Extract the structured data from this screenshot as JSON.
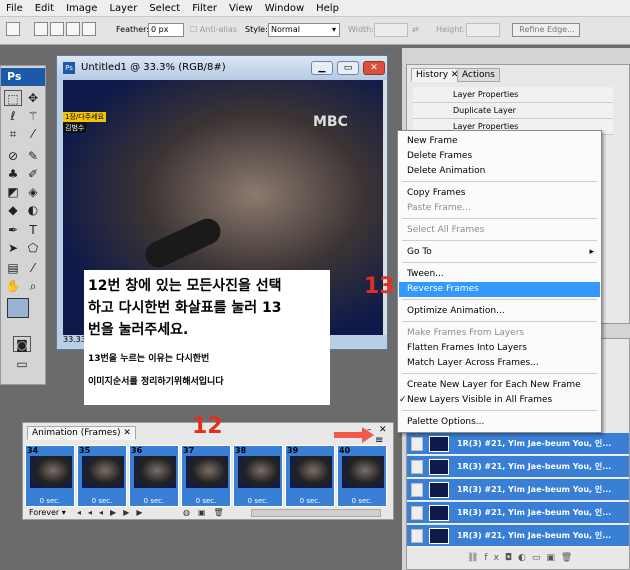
{
  "menubar": [
    "File",
    "Edit",
    "Image",
    "Layer",
    "Select",
    "Filter",
    "View",
    "Window",
    "Help"
  ],
  "options": {
    "feather_label": "Feather:",
    "feather_value": "0 px",
    "antialias_label": "Anti-alias",
    "style_label": "Style:",
    "style_value": "Normal",
    "width_label": "Width:",
    "height_label": "Height:",
    "refine_edge": "Refine Edge..."
  },
  "tools": {
    "ps_label": "Ps"
  },
  "document": {
    "title": "Untitled1 @ 33.3% (RGB/8#)",
    "zoom": "33.33",
    "overlay_tags": [
      "1장/다주세요",
      "김범수"
    ],
    "broadcast_logo": "MBC"
  },
  "note": {
    "line1": "12번 창에 있는 모든사진을 선택",
    "line2": "하고 다시한번 화살표를 눌러 13",
    "line3": "번을 눌러주세요.",
    "line4": "13번을 누르는 이유는 다시한번",
    "line5": "이미지순서를 정리하기위해서입니다"
  },
  "markers": {
    "m12": "12",
    "m13": "13"
  },
  "history": {
    "tabs": [
      "History",
      "Actions"
    ],
    "rows": [
      "Layer Properties",
      "Duplicate Layer",
      "Layer Properties"
    ]
  },
  "menu": {
    "items": [
      {
        "label": "New Frame",
        "disabled": false
      },
      {
        "label": "Delete Frames",
        "disabled": false
      },
      {
        "label": "Delete Animation",
        "disabled": false
      },
      {
        "label": "Copy Frames",
        "disabled": false
      },
      {
        "label": "Paste Frame...",
        "disabled": true
      },
      {
        "label": "Select All Frames",
        "disabled": true
      },
      {
        "label": "Go To",
        "disabled": false
      },
      {
        "label": "Tween...",
        "disabled": false
      },
      {
        "label": "Reverse Frames",
        "disabled": false
      },
      {
        "label": "Optimize Animation...",
        "disabled": false
      },
      {
        "label": "Make Frames From Layers",
        "disabled": true
      },
      {
        "label": "Flatten Frames Into Layers",
        "disabled": false
      },
      {
        "label": "Match Layer Across Frames...",
        "disabled": false
      },
      {
        "label": "Create New Layer for Each New Frame",
        "disabled": false
      },
      {
        "label": "New Layers Visible in All Frames",
        "disabled": false
      },
      {
        "label": "Palette Options...",
        "disabled": false
      }
    ],
    "highlighted": "Reverse Frames",
    "checked": "New Layers Visible in All Frames"
  },
  "animation": {
    "tab": "Animation (Frames)",
    "frames": [
      {
        "num": "34",
        "dur": "0 sec."
      },
      {
        "num": "35",
        "dur": "0 sec."
      },
      {
        "num": "36",
        "dur": "0 sec."
      },
      {
        "num": "37",
        "dur": "0 sec."
      },
      {
        "num": "38",
        "dur": "0 sec."
      },
      {
        "num": "39",
        "dur": "0 sec."
      },
      {
        "num": "40",
        "dur": "0 sec."
      }
    ],
    "loop": "Forever"
  },
  "layers": {
    "rows": [
      "1R(3) #21, Yim Jae-beum  You, 인...",
      "1R(3) #21, Yim Jae-beum  You, 인...",
      "1R(3) #21, Yim Jae-beum  You, 인...",
      "1R(3) #21, Yim Jae-beum  You, 인...",
      "1R(3) #21, Yim Jae-beum  You, 인..."
    ]
  },
  "colors": {
    "accent": "#3399ff",
    "frame_bg": "#3a7fd6",
    "marker": "#e03020",
    "ps_blue": "#1b5aa8"
  }
}
